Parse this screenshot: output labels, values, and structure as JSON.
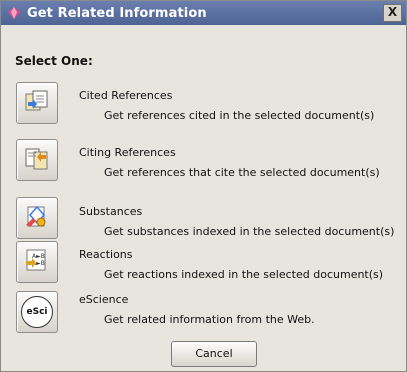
{
  "window": {
    "title": "Get Related Information",
    "close_label": "X"
  },
  "prompt": "Select One:",
  "options": [
    {
      "title": "Cited References",
      "description": "Get references cited in the selected document(s)",
      "icon": "cited-references-icon"
    },
    {
      "title": "Citing References",
      "description": "Get references that cite the selected document(s)",
      "icon": "citing-references-icon"
    },
    {
      "title": "Substances",
      "description": "Get substances indexed in the selected document(s)",
      "icon": "substances-icon"
    },
    {
      "title": "Reactions",
      "description": "Get reactions indexed in the selected document(s)",
      "icon": "reactions-icon"
    },
    {
      "title": "eScience",
      "description": "Get related information from the Web.",
      "icon": "escience-icon",
      "icon_text": "eSci"
    }
  ],
  "buttons": {
    "cancel": "Cancel"
  },
  "colors": {
    "titlebar": "#5a6fa2",
    "background": "#e8e5de"
  }
}
